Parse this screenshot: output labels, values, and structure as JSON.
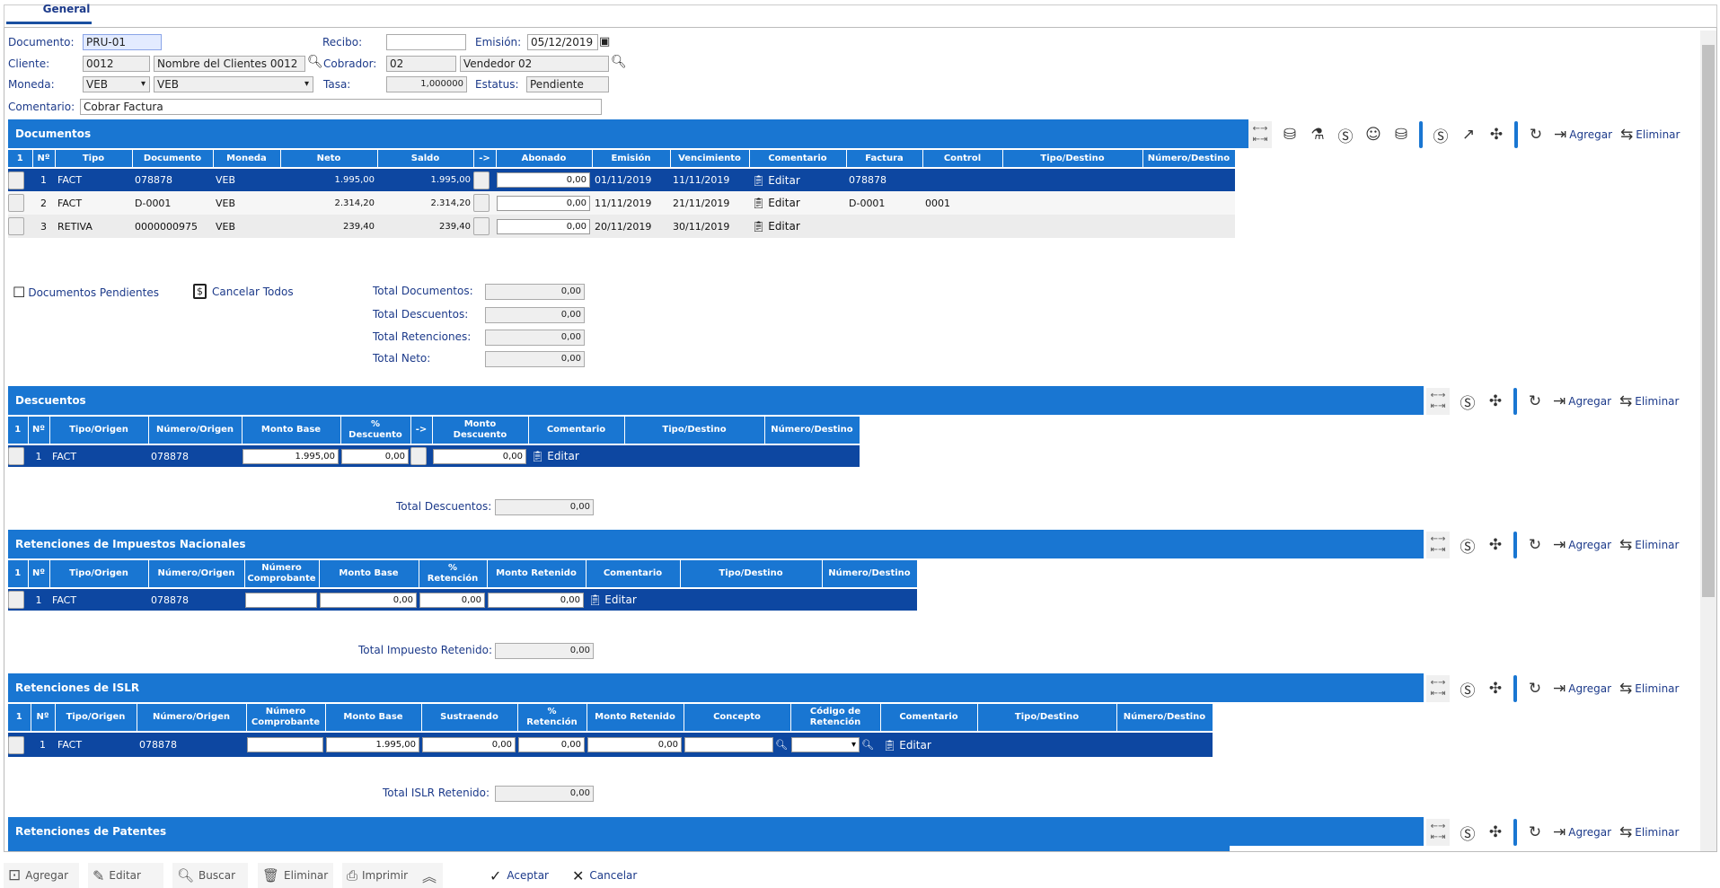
{
  "tabs": [
    {
      "label": "General"
    }
  ],
  "form": {
    "documento_label": "Documento:",
    "documento": "PRU-01",
    "recibo_label": "Recibo:",
    "recibo": "",
    "emision_label": "Emisión:",
    "emision": "05/12/2019",
    "cliente_label": "Cliente:",
    "cliente_code": "0012",
    "cliente_name": "Nombre del Clientes 0012",
    "cobrador_label": "Cobrador:",
    "cobrador_code": "02",
    "cobrador_name": "Vendedor 02",
    "moneda_label": "Moneda:",
    "moneda_code": "VEB",
    "moneda_name": "VEB",
    "tasa_label": "Tasa:",
    "tasa": "1,000000",
    "estatus_label": "Estatus:",
    "estatus": "Pendiente",
    "comentario_label": "Comentario:",
    "comentario": "Cobrar Factura"
  },
  "toolbar": {
    "agregar": "Agregar",
    "eliminar": "Eliminar"
  },
  "documentos": {
    "title": "Documentos",
    "headers": [
      "1",
      "Nº",
      "Tipo",
      "Documento",
      "Moneda",
      "Neto",
      "Saldo",
      "->",
      "Abonado",
      "Emisión",
      "Vencimiento",
      "Comentario",
      "Factura",
      "Control",
      "Tipo/Destino",
      "Número/Destino"
    ],
    "rows": [
      [
        "",
        "1",
        "FACT",
        "078878",
        "VEB",
        "1.995,00",
        "1.995,00",
        "",
        "0,00",
        "01/11/2019",
        "11/11/2019",
        "Editar",
        "078878",
        "",
        "",
        ""
      ],
      [
        "",
        "2",
        "FACT",
        "D-0001",
        "VEB",
        "2.314,20",
        "2.314,20",
        "",
        "0,00",
        "11/11/2019",
        "21/11/2019",
        "Editar",
        "D-0001",
        "0001",
        "",
        ""
      ],
      [
        "",
        "3",
        "RETIVA",
        "0000000975",
        "VEB",
        "239,40",
        "239,40",
        "",
        "0,00",
        "20/11/2019",
        "30/11/2019",
        "Editar",
        "",
        "",
        "",
        ""
      ]
    ]
  },
  "links": {
    "pendientes": "Documentos Pendientes",
    "cancelar_todos": "Cancelar Todos"
  },
  "totals": [
    {
      "label": "Total Documentos:",
      "value": "0,00"
    },
    {
      "label": "Total Descuentos:",
      "value": "0,00"
    },
    {
      "label": "Total Retenciones:",
      "value": "0,00"
    },
    {
      "label": "Total Neto:",
      "value": "0,00"
    }
  ],
  "descuentos": {
    "title": "Descuentos",
    "headers": [
      "1",
      "Nº",
      "Tipo/Origen",
      "Número/Origen",
      "Monto Base",
      "%\nDescuento",
      "->",
      "Monto\nDescuento",
      "Comentario",
      "Tipo/Destino",
      "Número/Destino"
    ],
    "rows": [
      [
        "",
        "1",
        "FACT",
        "078878",
        "1.995,00",
        "0,00",
        "",
        "0,00",
        "Editar",
        "",
        ""
      ]
    ],
    "total_label": "Total Descuentos:",
    "total": "0,00"
  },
  "ret_nacionales": {
    "title": "Retenciones de Impuestos Nacionales",
    "headers": [
      "1",
      "Nº",
      "Tipo/Origen",
      "Número/Origen",
      "Número\nComprobante",
      "Monto Base",
      "%\nRetención",
      "Monto Retenido",
      "Comentario",
      "Tipo/Destino",
      "Número/Destino"
    ],
    "rows": [
      [
        "",
        "1",
        "FACT",
        "078878",
        "",
        "0,00",
        "0,00",
        "0,00",
        "Editar",
        "",
        ""
      ]
    ],
    "total_label": "Total Impuesto Retenido:",
    "total": "0,00"
  },
  "ret_islr": {
    "title": "Retenciones de ISLR",
    "headers": [
      "1",
      "Nº",
      "Tipo/Origen",
      "Número/Origen",
      "Número\nComprobante",
      "Monto Base",
      "Sustraendo",
      "%\nRetención",
      "Monto Retenido",
      "Concepto",
      "Código de\nRetención",
      "Comentario",
      "Tipo/Destino",
      "Número/Destino"
    ],
    "rows": [
      [
        "",
        "1",
        "FACT",
        "078878",
        "",
        "1.995,00",
        "0,00",
        "0,00",
        "0,00",
        "",
        "",
        "Editar",
        "",
        ""
      ]
    ],
    "total_label": "Total ISLR Retenido:",
    "total": "0,00"
  },
  "ret_patentes": {
    "title": "Retenciones de Patentes"
  },
  "bottom": {
    "agregar": "Agregar",
    "editar": "Editar",
    "buscar": "Buscar",
    "eliminar": "Eliminar",
    "imprimir": "Imprimir",
    "aceptar": "Aceptar",
    "cancelar": "Cancelar"
  },
  "colors": {
    "header": "#1976d2",
    "selected_row": "#0d47a1",
    "label": "#1c3a8a"
  }
}
